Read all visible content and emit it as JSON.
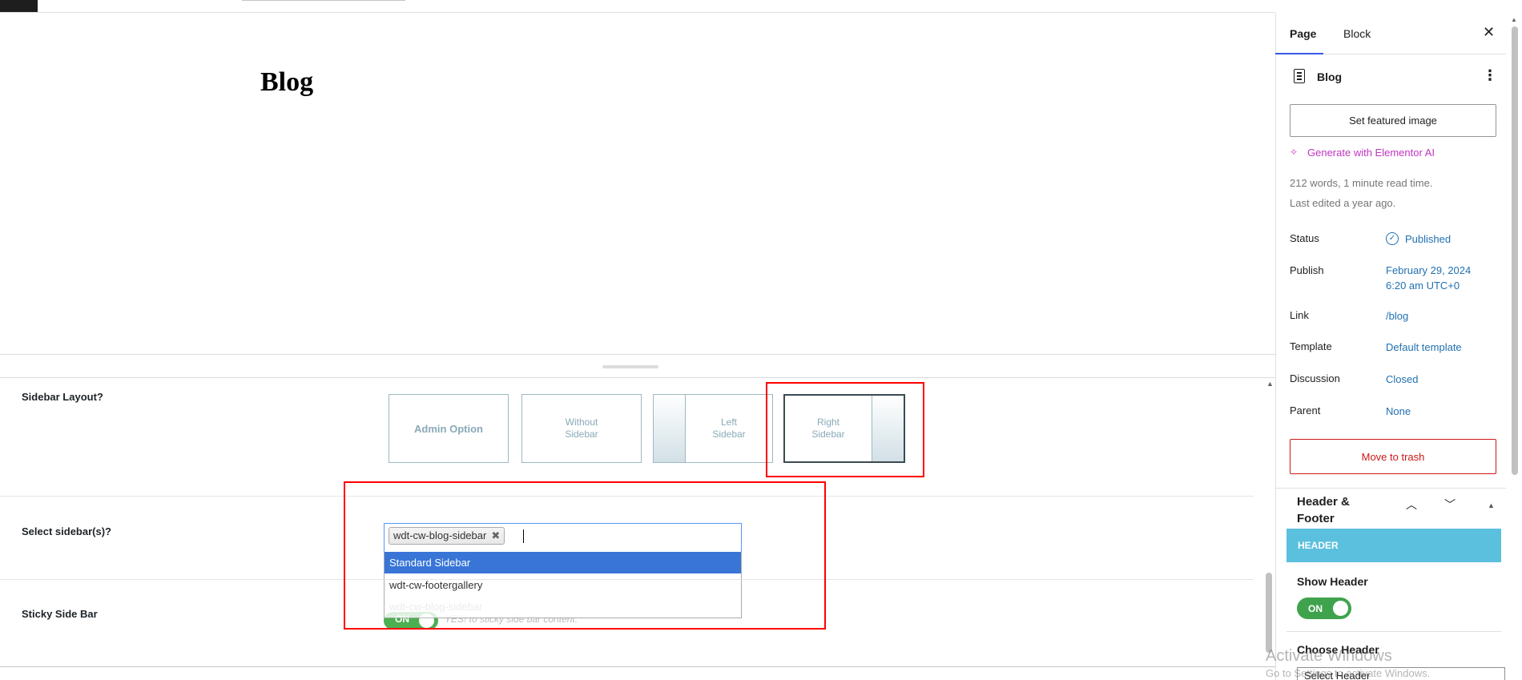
{
  "editor": {
    "page_title": "Blog"
  },
  "meta_box": {
    "sidebar_layout": {
      "label": "Sidebar Layout?",
      "options": [
        "Admin Option",
        "Without Sidebar",
        "Left Sidebar",
        "Right Sidebar"
      ],
      "selected": "Right Sidebar"
    },
    "select_sidebar": {
      "label": "Select sidebar(s)?",
      "selected_chip": "wdt-cw-blog-sidebar",
      "chip_remove": "✖",
      "dropdown_options": [
        "Standard Sidebar",
        "wdt-cw-footergallery",
        "wdt-cw-blog-sidebar"
      ],
      "highlighted": "Standard Sidebar"
    },
    "sticky_sidebar": {
      "label": "Sticky Side Bar",
      "toggle_text": "ON",
      "help_text": "YES! to sticky side bar content."
    }
  },
  "settings_sidebar": {
    "tabs": [
      "Page",
      "Block"
    ],
    "active_tab": "Page",
    "close_icon": "✕",
    "doc_title": "Blog",
    "kebab_icon": "⋮",
    "featured_image_button": "Set featured image",
    "ai_icon": "✧",
    "ai_link": "Generate with Elementor AI",
    "words_info": "212 words, 1 minute read time.",
    "edited_info": "Last edited a year ago.",
    "status": {
      "label": "Status",
      "value": "Published",
      "icon": "✓"
    },
    "publish": {
      "label": "Publish",
      "value_line1": "February 29, 2024",
      "value_line2": "6:20 am UTC+0"
    },
    "link": {
      "label": "Link",
      "value": "/blog"
    },
    "template": {
      "label": "Template",
      "value": "Default template"
    },
    "discussion": {
      "label": "Discussion",
      "value": "Closed"
    },
    "parent": {
      "label": "Parent",
      "value": "None"
    },
    "trash_button": "Move to trash",
    "header_footer": {
      "title": "Header & Footer",
      "up_icon": "︿",
      "down_icon": "﹀",
      "toggle_icon": "▲",
      "section_bar": "HEADER",
      "show_header_label": "Show Header",
      "show_header_toggle": "ON",
      "choose_header_label": "Choose Header",
      "select_header_value": "Select Header"
    }
  },
  "scroll_icons": {
    "meta_up": "▲",
    "sidebar_up": "▲"
  },
  "watermark": {
    "line1": "Activate Windows",
    "line2": "Go to Settings to activate Windows."
  },
  "colors": {
    "accent": "#3858e9",
    "link": "#2271b1",
    "danger": "#cc1818",
    "highlight": "#3875d7",
    "header_bar": "#5bc0de",
    "toggle_on": "#3fa34d",
    "annotation": "#ff0000"
  }
}
